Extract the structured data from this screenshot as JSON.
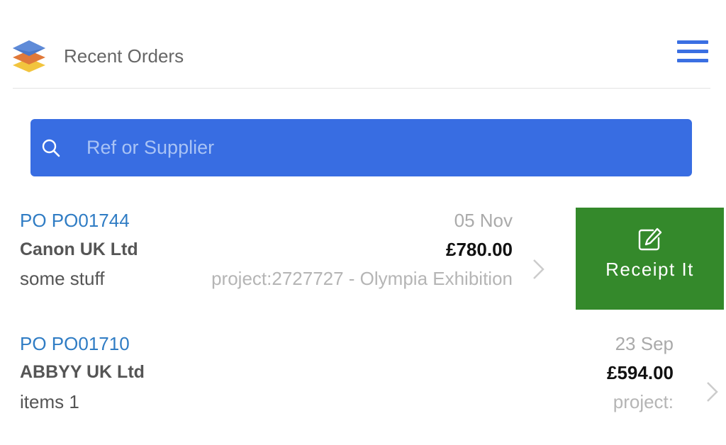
{
  "header": {
    "title": "Recent Orders",
    "logo_icon": "layers-logo-icon",
    "menu_icon": "hamburger-menu-icon",
    "accent_color": "#3a6fe2"
  },
  "search": {
    "placeholder": "Ref or Supplier",
    "value": "",
    "icon": "search-icon",
    "background_color": "#386de2"
  },
  "orders": [
    {
      "ref": "PO PO01744",
      "supplier": "Canon UK Ltd",
      "description": "some stuff",
      "date": "05 Nov",
      "amount": "£780.00",
      "project": "project:2727727 - Olympia Exhibition",
      "action": {
        "label": "Receipt It",
        "icon": "edit-icon",
        "color": "#34892b"
      }
    },
    {
      "ref": "PO PO01710",
      "supplier": "ABBYY UK Ltd",
      "description": "items 1",
      "date": "23 Sep",
      "amount": "£594.00",
      "project": "project:"
    }
  ]
}
